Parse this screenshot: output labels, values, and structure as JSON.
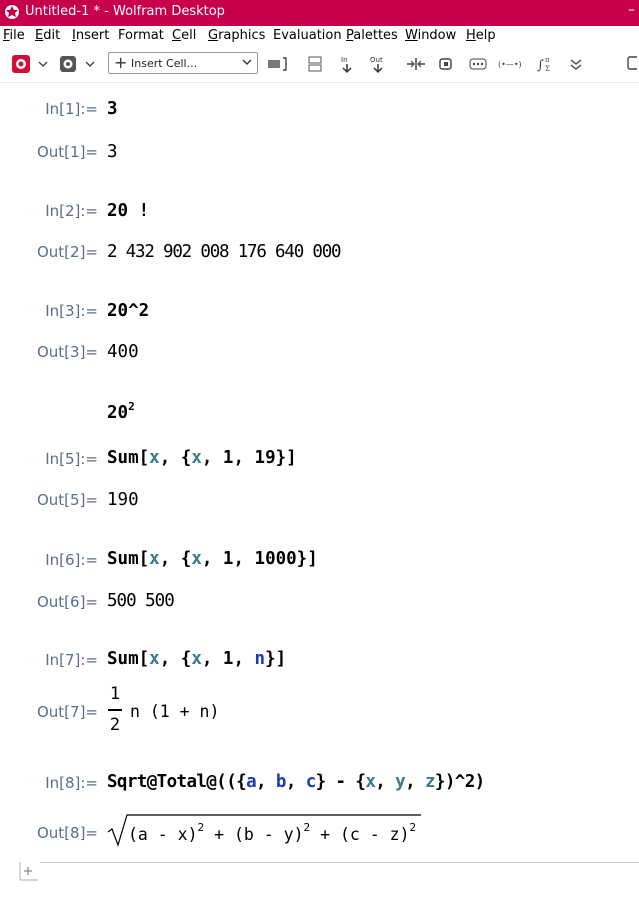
{
  "window": {
    "title": "Untitled-1 * - Wolfram Desktop",
    "minimize": "–"
  },
  "menu": [
    {
      "key": "F",
      "rest": "ile"
    },
    {
      "key": "E",
      "rest": "dit"
    },
    {
      "key": "I",
      "rest": "nsert"
    },
    {
      "key": "",
      "rest": "Format"
    },
    {
      "key": "C",
      "rest": "ell"
    },
    {
      "key": "G",
      "rest": "raphics"
    },
    {
      "key": "",
      "rest": "Evaluation"
    },
    {
      "key": "P",
      "rest": "alettes"
    },
    {
      "key": "W",
      "rest": "indow"
    },
    {
      "key": "H",
      "rest": "elp"
    }
  ],
  "toolbar": {
    "insert_cell_label": "Insert Cell..."
  },
  "cells": {
    "in1": {
      "label": "In[1]:=",
      "code": "3"
    },
    "out1": {
      "label": "Out[1]=",
      "value": "3"
    },
    "in2": {
      "label": "In[2]:=",
      "code": "20 !"
    },
    "out2": {
      "label": "Out[2]=",
      "value": "2 432 902 008 176 640 000"
    },
    "in3": {
      "label": "In[3]:=",
      "code": "20^2"
    },
    "out3": {
      "label": "Out[3]=",
      "value": "400"
    },
    "in4": {
      "base": "20",
      "exp": "2"
    },
    "in5": {
      "label": "In[5]:=",
      "code_pre": "Sum[",
      "var1": "x",
      "code_mid": ", {",
      "var2": "x",
      "code_post": ", 1, 19}]"
    },
    "out5": {
      "label": "Out[5]=",
      "value": "190"
    },
    "in6": {
      "label": "In[6]:=",
      "code_pre": "Sum[",
      "var1": "x",
      "code_mid": ", {",
      "var2": "x",
      "code_post": ", 1, 1000}]"
    },
    "out6": {
      "label": "Out[6]=",
      "value": "500 500"
    },
    "in7": {
      "label": "In[7]:=",
      "code_pre": "Sum[",
      "var1": "x",
      "code_mid": ", {",
      "var2": "x",
      "code_mid2": ", 1, ",
      "var3": "n",
      "code_post": "}]"
    },
    "out7": {
      "label": "Out[7]=",
      "num": "1",
      "den": "2",
      "rest": "n (1 + n)"
    },
    "in8": {
      "label": "In[8]:=",
      "code_pre": "Sqrt@Total@(({",
      "a": "a",
      "b": "b",
      "c": "c",
      "mid": "} - {",
      "x": "x",
      "y": "y",
      "z": "z",
      "post": "})^2)"
    },
    "out8": {
      "label": "Out[8]=",
      "t1": "(a - x)",
      "t2": "(b - y)",
      "t3": "(c - z)",
      "plus": "+",
      "exp": "2"
    }
  }
}
